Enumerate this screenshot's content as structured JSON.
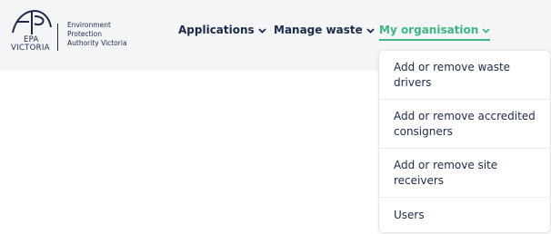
{
  "logo": {
    "abbr": "EPA",
    "state": "VICTORIA",
    "org_line1": "Environment",
    "org_line2": "Protection",
    "org_line3": "Authority Victoria"
  },
  "nav": {
    "items": [
      {
        "label": "Applications",
        "icon": "chevron-down-icon"
      },
      {
        "label": "Manage waste",
        "icon": "chevron-down-icon"
      },
      {
        "label": "My organisation",
        "icon": "chevron-down-icon",
        "active": true
      }
    ]
  },
  "dropdown": {
    "items": [
      {
        "label": "Add or remove waste drivers"
      },
      {
        "label": "Add or remove accredited consigners"
      },
      {
        "label": "Add or remove site receivers"
      },
      {
        "label": "Users"
      }
    ]
  },
  "colors": {
    "primary_text": "#1b2a4a",
    "accent": "#3fb681",
    "header_bg": "#f4f5f7"
  }
}
